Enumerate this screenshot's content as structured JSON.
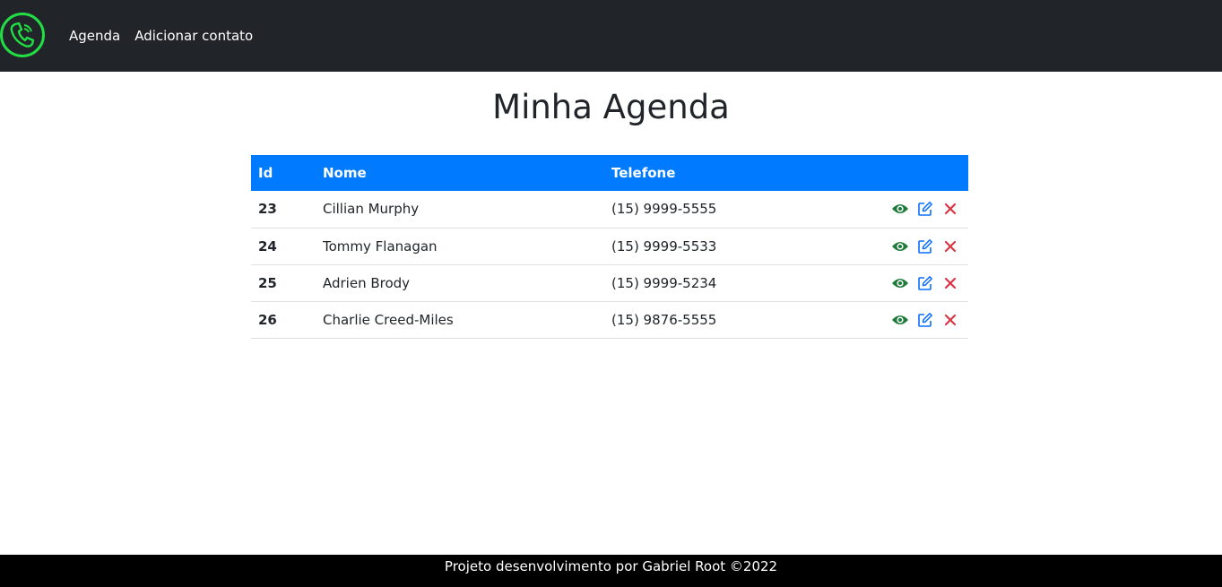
{
  "navbar": {
    "logo_icon": "phone-icon",
    "links": [
      {
        "label": "Agenda"
      },
      {
        "label": "Adicionar contato"
      }
    ]
  },
  "main": {
    "title": "Minha Agenda",
    "table": {
      "headers": {
        "id": "Id",
        "nome": "Nome",
        "telefone": "Telefone",
        "acoes": ""
      },
      "rows": [
        {
          "id": "23",
          "nome": "Cillian Murphy",
          "telefone": "(15) 9999-5555"
        },
        {
          "id": "24",
          "nome": "Tommy Flanagan",
          "telefone": "(15) 9999-5533"
        },
        {
          "id": "25",
          "nome": "Adrien Brody",
          "telefone": "(15) 9999-5234"
        },
        {
          "id": "26",
          "nome": "Charlie Creed-Miles",
          "telefone": "(15) 9876-5555"
        }
      ],
      "row_action_icons": [
        "eye-icon",
        "edit-icon",
        "close-icon"
      ]
    }
  },
  "footer": {
    "text": "Projeto desenvolvimento por Gabriel Root ©2022"
  },
  "colors": {
    "navbar_bg": "#212529",
    "logo_green": "#22dd44",
    "table_header": "#007bff",
    "view_green": "#1e7b3a",
    "edit_blue": "#0d6efd",
    "delete_red": "#dc3545",
    "footer_bg": "#000000"
  }
}
